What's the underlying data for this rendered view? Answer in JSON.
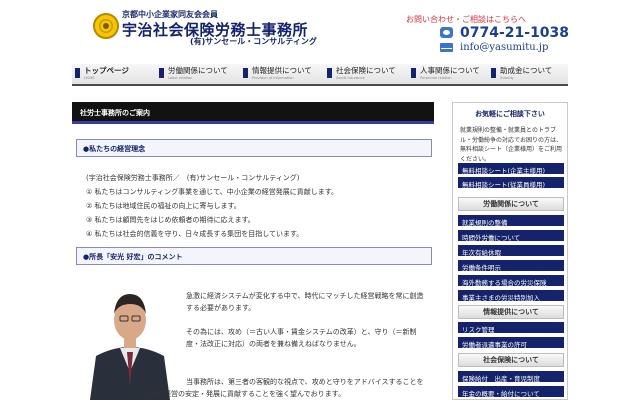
{
  "header": {
    "association": "京都中小企業家同友会会員",
    "office_name": "宇治社会保険労務士事務所",
    "company": "(有)サンセール・コンサルティング",
    "contact_label": "お問い合わせ・ご相談はこちらへ",
    "phone": "0774-21-1038",
    "email": "info@yasumitu.jp"
  },
  "nav": [
    {
      "jp": "トップページ",
      "en": "HOME"
    },
    {
      "jp": "労働関係について",
      "en": "Labor relation"
    },
    {
      "jp": "情報提供について",
      "en": "Provision of information"
    },
    {
      "jp": "社会保険について",
      "en": "Social insurance"
    },
    {
      "jp": "人事関係について",
      "en": "Personnel relation"
    },
    {
      "jp": "助成金について",
      "en": "Subsidy"
    }
  ],
  "main": {
    "page_title": "社労士事務所のご案内",
    "philosophy_heading": "●私たちの経営理念",
    "philosophy_intro": "(宇治社会保険労務士事務所／　(有)サンセール・コンサルティング)",
    "philosophy_items": [
      "① 私たちはコンサルティング事業を通じて、中小企業の経営発展に貢献します。",
      "② 私たちは地域住民の福祉の向上に寄与します。",
      "③ 私たちは顧問先をはじめ依頼者の期待に応えます。",
      "④ 私たちは社会的信義を守り、日々成長する集団を目指しています。"
    ],
    "comment_heading": "●所長「安光 好宏」のコメント",
    "comment_p1": "急激に経済システムが変化する中で、時代にマッチした経営戦略を常に創造する必要があります。",
    "comment_p2": "その為には、攻め（＝古い人事・賃金システムの改革）と、守り（＝新制度・法改正に対応）の両者を兼ね備えねばなりません。",
    "comment_p3a": "当事務所は、第三者の客観的な視点で、攻めと守りをアドバイスすることを",
    "comment_p3b": "通じ、中小企業の経営の安定・発展に貢献することを強く望んでおります。"
  },
  "sidebar": {
    "consult_title": "お気軽にご相談下さい",
    "consult_text": "就業規則の整備・就業員とのトラブル・労働紛争の対応でお困りの方は、無料相談シート（企業様用）をご利用ください。",
    "consult_links": [
      "無料相談シート(企業主様用)",
      "無料相談シート(従業員様用)"
    ],
    "categories": [
      {
        "title": "労働関係について",
        "items": [
          "就業規則の整備",
          "時間外労働について",
          "年次有給休暇",
          "労働条件明示",
          "海外勤務する場合の労災保険",
          "事業主さまの労災特別加入"
        ]
      },
      {
        "title": "情報提供について",
        "items": [
          "リスク管理",
          "労働者派遣事業の許可"
        ]
      },
      {
        "title": "社会保険について",
        "items": [
          "保険給付　出産・育児制度",
          "年金の概要・給付について"
        ]
      }
    ]
  },
  "colors": {
    "navy": "#14236b",
    "accent_red": "#d4303a",
    "bar_black": "#121212"
  }
}
